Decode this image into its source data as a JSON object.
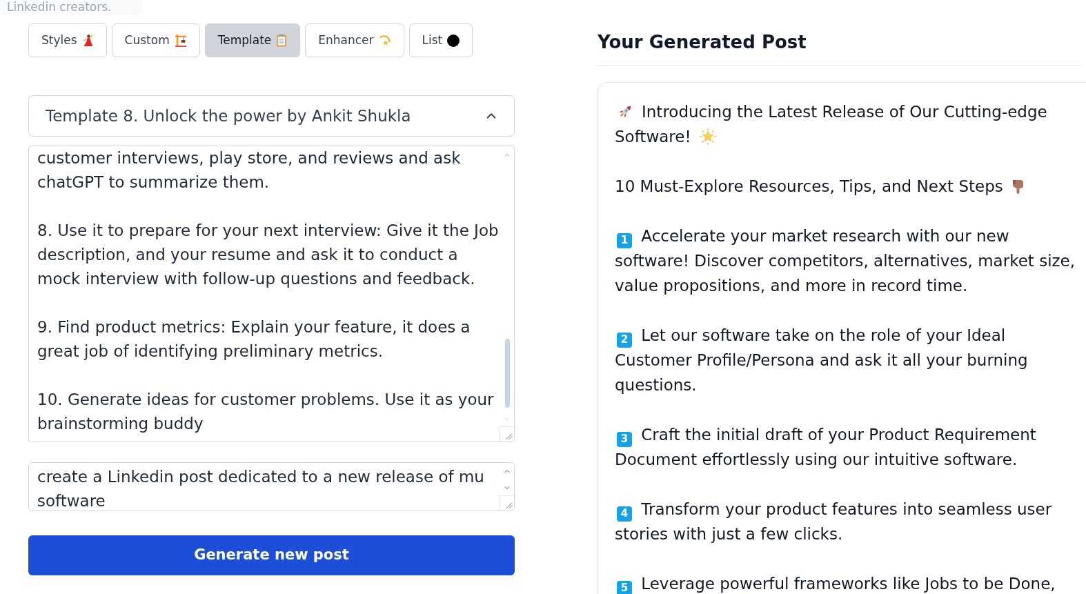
{
  "header_fragment": "Linkedin creators.",
  "tabs": [
    {
      "label": "Styles",
      "selected": false
    },
    {
      "label": "Custom",
      "selected": false
    },
    {
      "label": "Template",
      "selected": true
    },
    {
      "label": "Enhancer",
      "selected": false
    },
    {
      "label": "List",
      "selected": false
    }
  ],
  "template_select": {
    "value": "Template 8. Unlock the power by Ankit Shukla",
    "expanded": true
  },
  "template_text": {
    "paragraphs": [
      [
        "customer interviews, play store, and reviews and ask",
        "chatGPT to summarize them."
      ],
      [
        "8. Use it to prepare for your next interview: Give it the Job",
        "description, and your resume and ask it to conduct a",
        "mock interview with follow-up questions and feedback."
      ],
      [
        "9. Find product metrics: Explain your feature, it does a",
        "great job of identifying preliminary metrics."
      ],
      [
        "10. Generate ideas for customer problems. Use it as your",
        "brainstorming buddy"
      ]
    ]
  },
  "prompt": {
    "value_lines": [
      "create a Linkedin post dedicated to a new release of mu",
      "software"
    ]
  },
  "generate_button": {
    "label": "Generate new post"
  },
  "output": {
    "heading": "Your Generated Post",
    "post": {
      "title_lines": [
        "Introducing the Latest Release of Our Cutting-edge",
        "Software!"
      ],
      "subtitle": "10 Must-Explore Resources, Tips, and Next Steps",
      "items": [
        {
          "number": "1",
          "lines": [
            "Accelerate your market research with our new",
            "software! Discover competitors, alternatives, market size,",
            "value propositions, and more in record time."
          ]
        },
        {
          "number": "2",
          "lines": [
            "Let our software take on the role of your Ideal",
            "Customer Profile/Persona and ask it all your burning",
            "questions."
          ]
        },
        {
          "number": "3",
          "lines": [
            "Craft the initial draft of your Product Requirement",
            "Document effortlessly using our intuitive software."
          ]
        },
        {
          "number": "4",
          "lines": [
            "Transform your product features into seamless user",
            "stories with just a few clicks."
          ]
        },
        {
          "number": "5",
          "lines": [
            "Leverage powerful frameworks like Jobs to be Done,"
          ]
        }
      ]
    }
  }
}
